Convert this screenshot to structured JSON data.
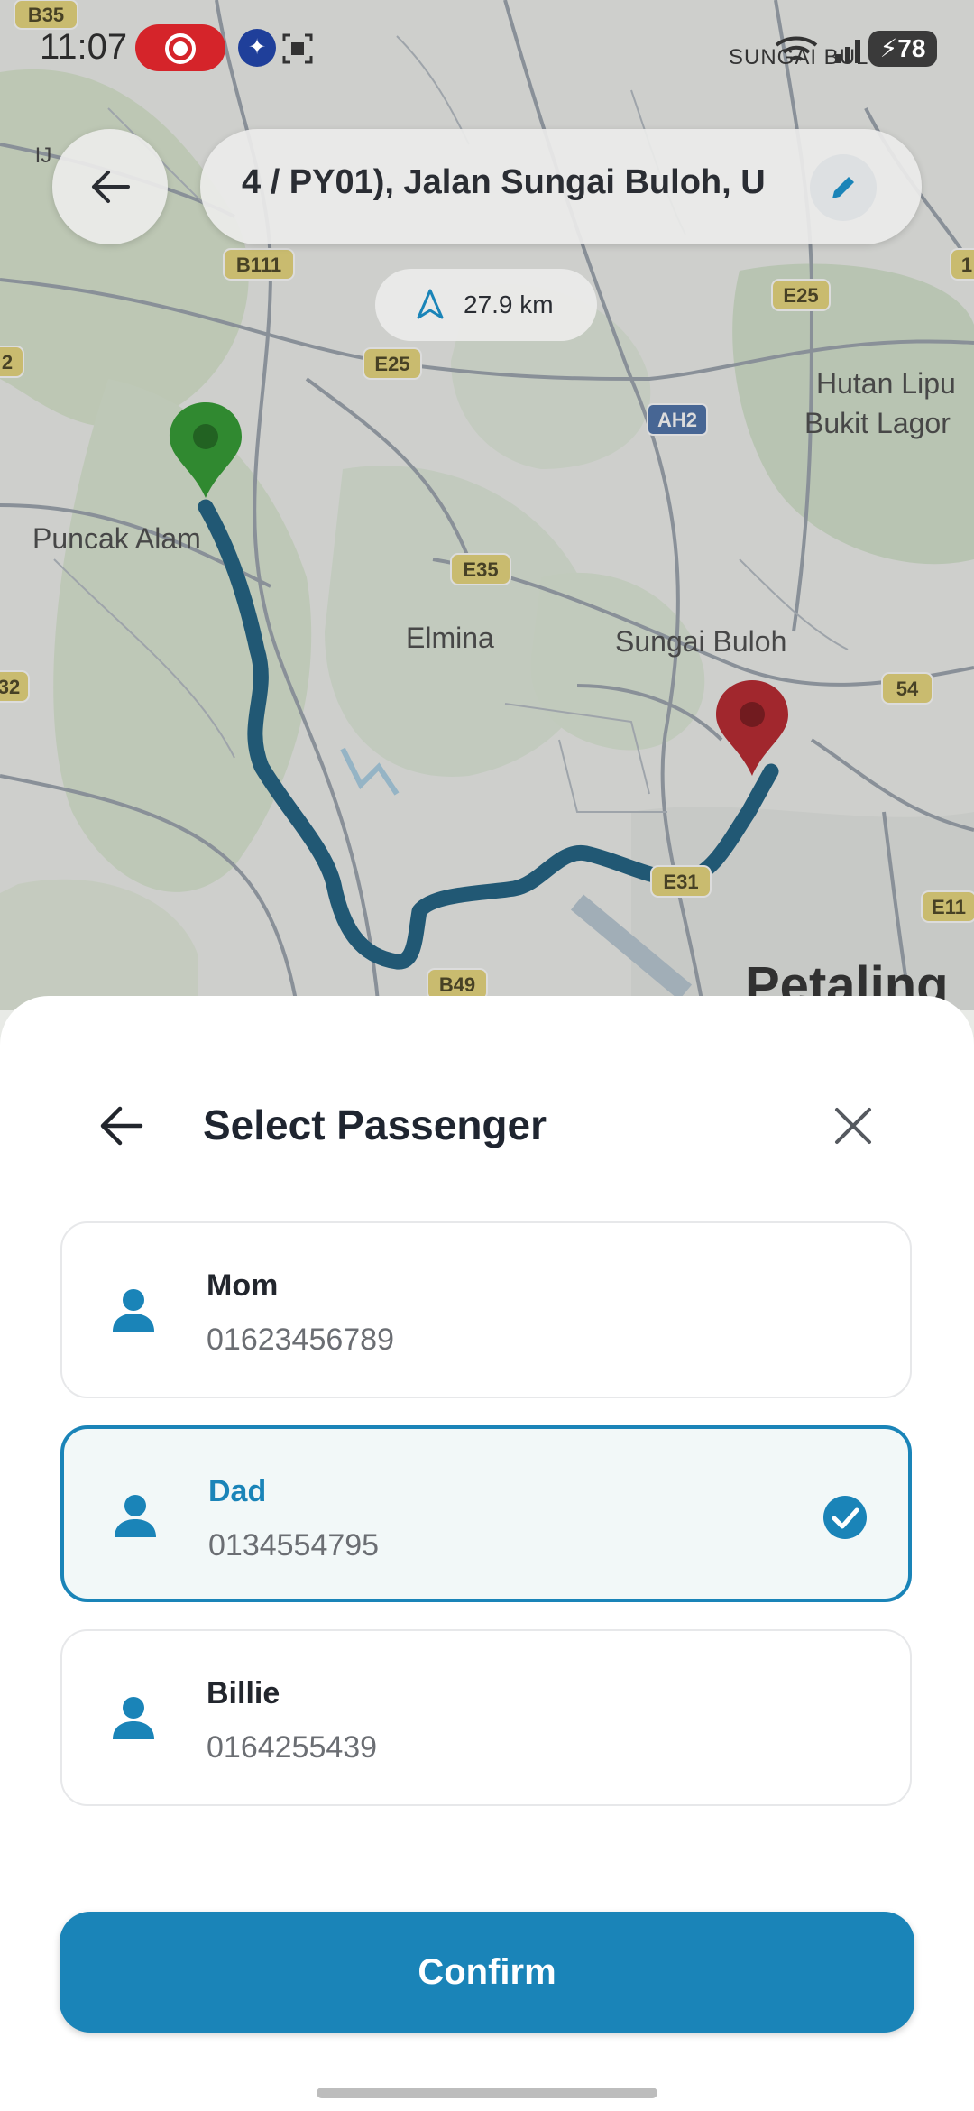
{
  "status_bar": {
    "time": "11:07",
    "carrier": "SUNGAI BUL",
    "battery": "78",
    "icons": [
      "screen-record-icon",
      "app-notification-icon",
      "screenshot-icon",
      "wifi-icon",
      "signal-icon",
      "battery-icon"
    ]
  },
  "map": {
    "labels": {
      "b35": "B35",
      "ij": "IJ",
      "b111": "B111",
      "e25a": "E25",
      "e25b": "E25",
      "ah2": "AH2",
      "hutan1": "Hutan Lipu",
      "hutan2": "Bukit Lagor",
      "puncak": "Puncak Alam",
      "e35": "E35",
      "elmina": "Elmina",
      "sungai": "Sungai Buloh",
      "r54": "54",
      "e31": "E31",
      "e11": "E11",
      "b49": "B49",
      "petaling": "Petaling",
      "r2": "2",
      "r32": "32",
      "r1": "1"
    }
  },
  "header": {
    "address": "4 / PY01), Jalan Sungai Buloh, U",
    "distance": "27.9 km"
  },
  "sheet": {
    "title": "Select Passenger",
    "passengers": [
      {
        "name": "Mom",
        "phone": "01623456789",
        "selected": false
      },
      {
        "name": "Dad",
        "phone": "0134554795",
        "selected": true
      },
      {
        "name": "Billie",
        "phone": "0164255439",
        "selected": false
      }
    ],
    "confirm_label": "Confirm"
  },
  "colors": {
    "accent": "#1a84b8",
    "route": "#1c5f80",
    "origin_pin": "#2e9a2e",
    "destination_pin": "#b8232a"
  }
}
